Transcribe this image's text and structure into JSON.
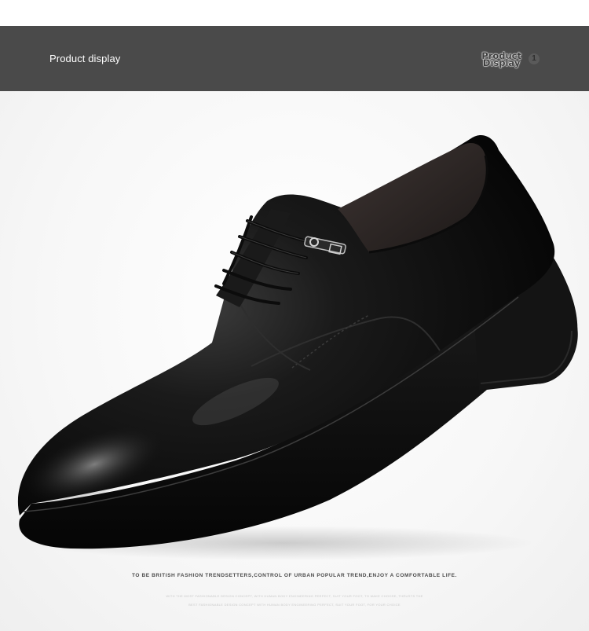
{
  "banner": {
    "title": "Product display",
    "badge_line1": "Product",
    "badge_line2": "Display",
    "badge_number": "1"
  },
  "image": {
    "subject": "black leather lace-up derby dress shoe",
    "icon": "shoe-product-photo"
  },
  "caption": {
    "slogan": "TO BE BRITISH FASHION TRENDSETTERS,CONTROL OF URBAN POPULAR TREND,ENJOY A COMFORTABLE LIFE.",
    "fine_print_1": "WITH THE MOST FASHIONABLE DESIGN CONCEPT, WITH HUMAN BODY ENGINEERING PERFECT, SUIT YOUR FOOT, TO MAKE CHOOSE, THRUSTS THE",
    "fine_print_2": "BEST FASHIONABLE DESIGN CONCEPT WITH HUMAN BODY ENGINEERING PERFECT, SUIT YOUR FOOT, FOR YOUR CHOICE"
  },
  "colors": {
    "banner_bg": "#4a4a4a",
    "banner_text": "#ffffff",
    "page_bg": "#ffffff"
  }
}
